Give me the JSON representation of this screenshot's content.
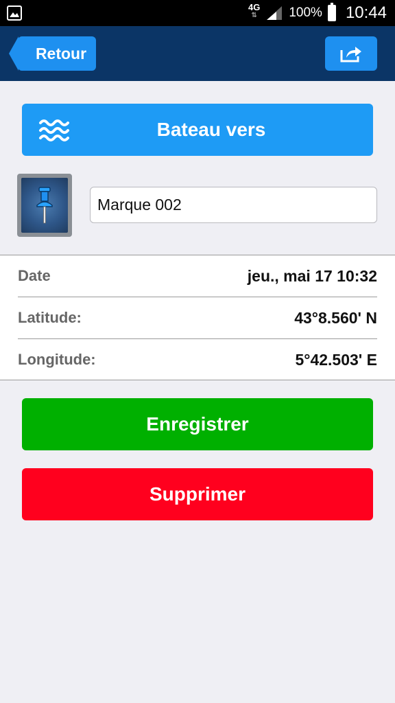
{
  "status_bar": {
    "network": "4G",
    "battery": "100%",
    "time": "10:44",
    "icons": [
      "gallery-icon",
      "signal-icon",
      "battery-icon"
    ]
  },
  "nav": {
    "back_label": "Retour",
    "share_icon": "share-icon"
  },
  "boat_to": {
    "label": "Bateau vers",
    "icon": "waves-icon"
  },
  "mark": {
    "icon": "pushpin-icon",
    "name_value": "Marque 002"
  },
  "info": [
    {
      "label": "Date",
      "value": "jeu., mai 17 10:32"
    },
    {
      "label": "Latitude:",
      "value": "43°8.560' N"
    },
    {
      "label": "Longitude:",
      "value": "5°42.503' E"
    }
  ],
  "actions": {
    "save_label": "Enregistrer",
    "delete_label": "Supprimer"
  },
  "colors": {
    "navbar": "#0b3566",
    "accent_blue": "#1e9bf5",
    "save_green": "#00b000",
    "delete_red": "#ff001e"
  }
}
